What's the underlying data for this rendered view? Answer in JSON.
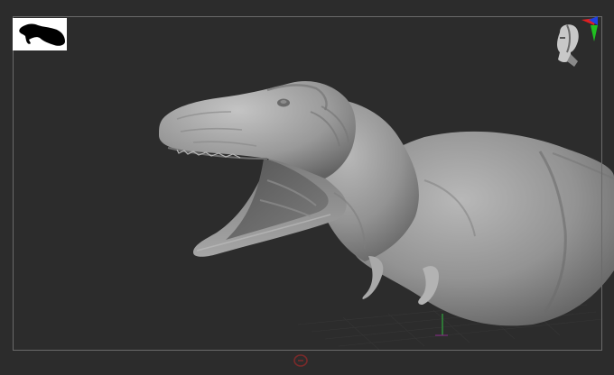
{
  "viewport": {
    "background_color": "#2c2c2c",
    "frame_color": "#6a6a6a",
    "model_color": "#9a9a9a"
  },
  "thumbnail": {
    "icon": "trex-silhouette-icon",
    "background_color": "#ffffff",
    "silhouette_color": "#000000"
  },
  "gizmo": {
    "icon": "head-orientation-gizmo-icon",
    "axis_colors": {
      "x": "#e02020",
      "y": "#20c020",
      "z": "#2040e0"
    }
  },
  "floor": {
    "grid_color": "#3a3a3a",
    "axis_color": "#2fbf3f",
    "marker_icon": "floor-pivot-icon",
    "marker_color": "#7a2a2a"
  }
}
